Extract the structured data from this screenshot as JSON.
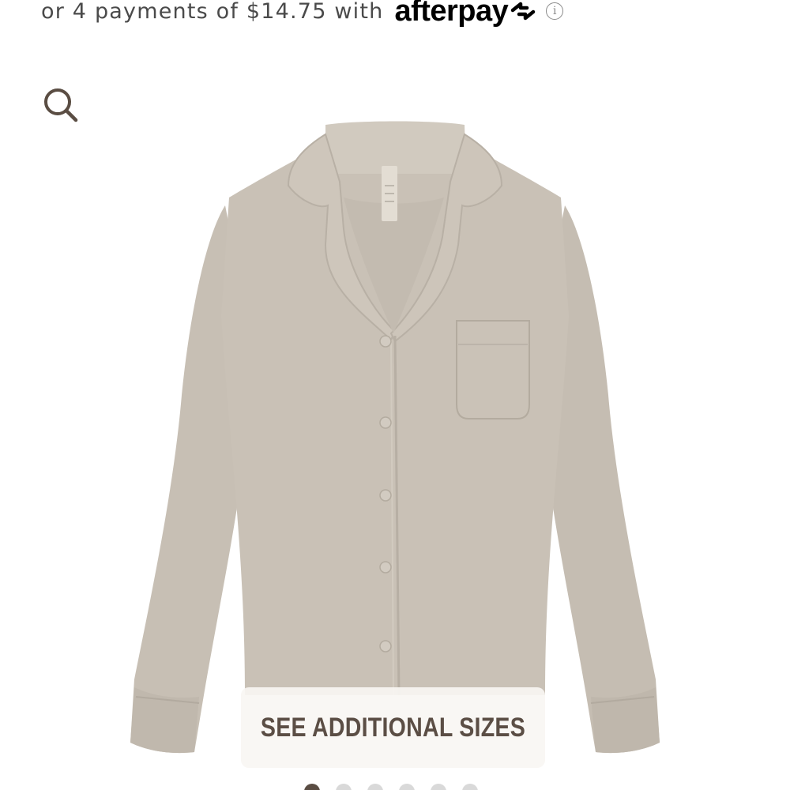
{
  "afterpay": {
    "text": "or 4 payments of $14.75 with",
    "logo_text": "afterpay",
    "info_icon": "info-icon",
    "info_glyph": "i"
  },
  "zoom": {
    "icon": "search-icon"
  },
  "product": {
    "image": "long-sleeve-button-up-sleep-shirt",
    "color": "#c9c1b6"
  },
  "sizes_button": {
    "label": "SEE ADDITIONAL SIZES"
  },
  "carousel": {
    "total": 6,
    "active_index": 0
  },
  "colors": {
    "accent": "#5a4d43",
    "text": "#4a4a4a"
  }
}
